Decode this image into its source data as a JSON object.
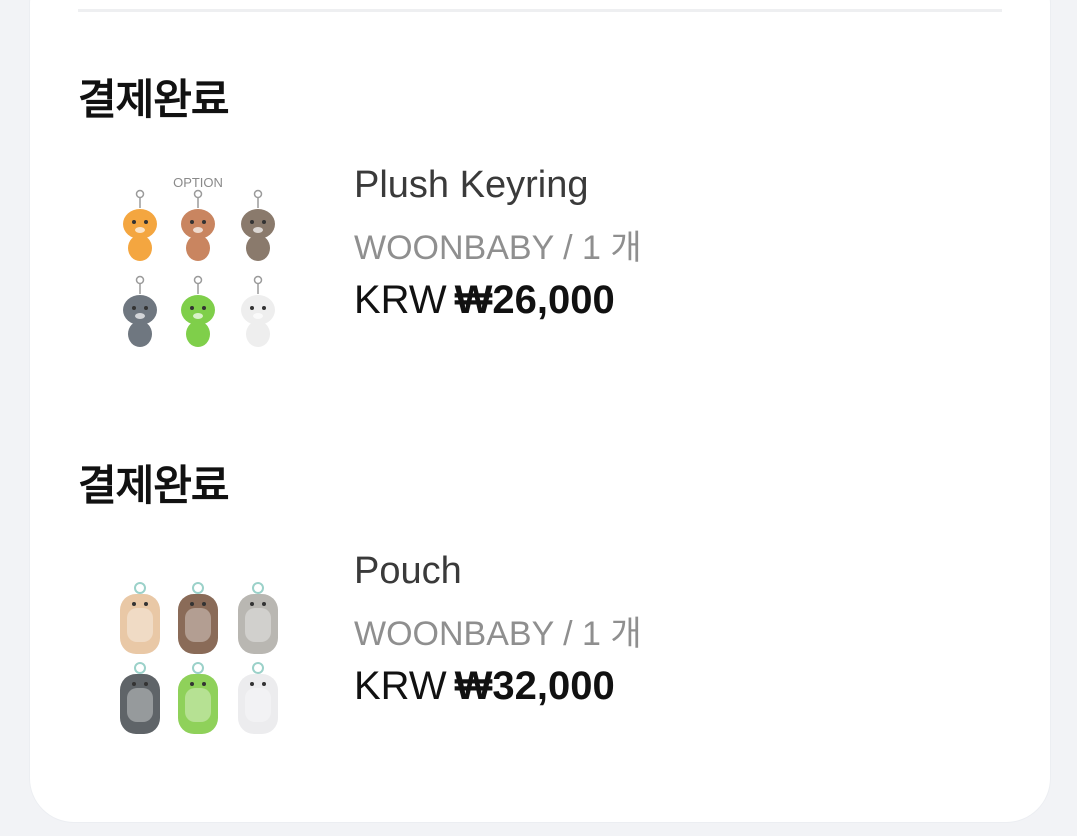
{
  "orders": [
    {
      "status": "결제완료",
      "product_name": "Plush Keyring",
      "brand": "WOONBABY",
      "separator": "/",
      "quantity": "1 개",
      "currency": "KRW",
      "price": "₩26,000",
      "thumbnail_caption": "OPTION",
      "thumbnail_colors": [
        "#f4a640",
        "#c98560",
        "#8a7a6c",
        "#6f7780",
        "#7fcf4a",
        "#eeeeee"
      ]
    },
    {
      "status": "결제완료",
      "product_name": "Pouch",
      "brand": "WOONBABY",
      "separator": "/",
      "quantity": "1 개",
      "currency": "KRW",
      "price": "₩32,000",
      "thumbnail_colors": [
        "#e9c8a6",
        "#8a6b58",
        "#b9b7b2",
        "#5f6468",
        "#8fd15a",
        "#ececee"
      ]
    }
  ]
}
